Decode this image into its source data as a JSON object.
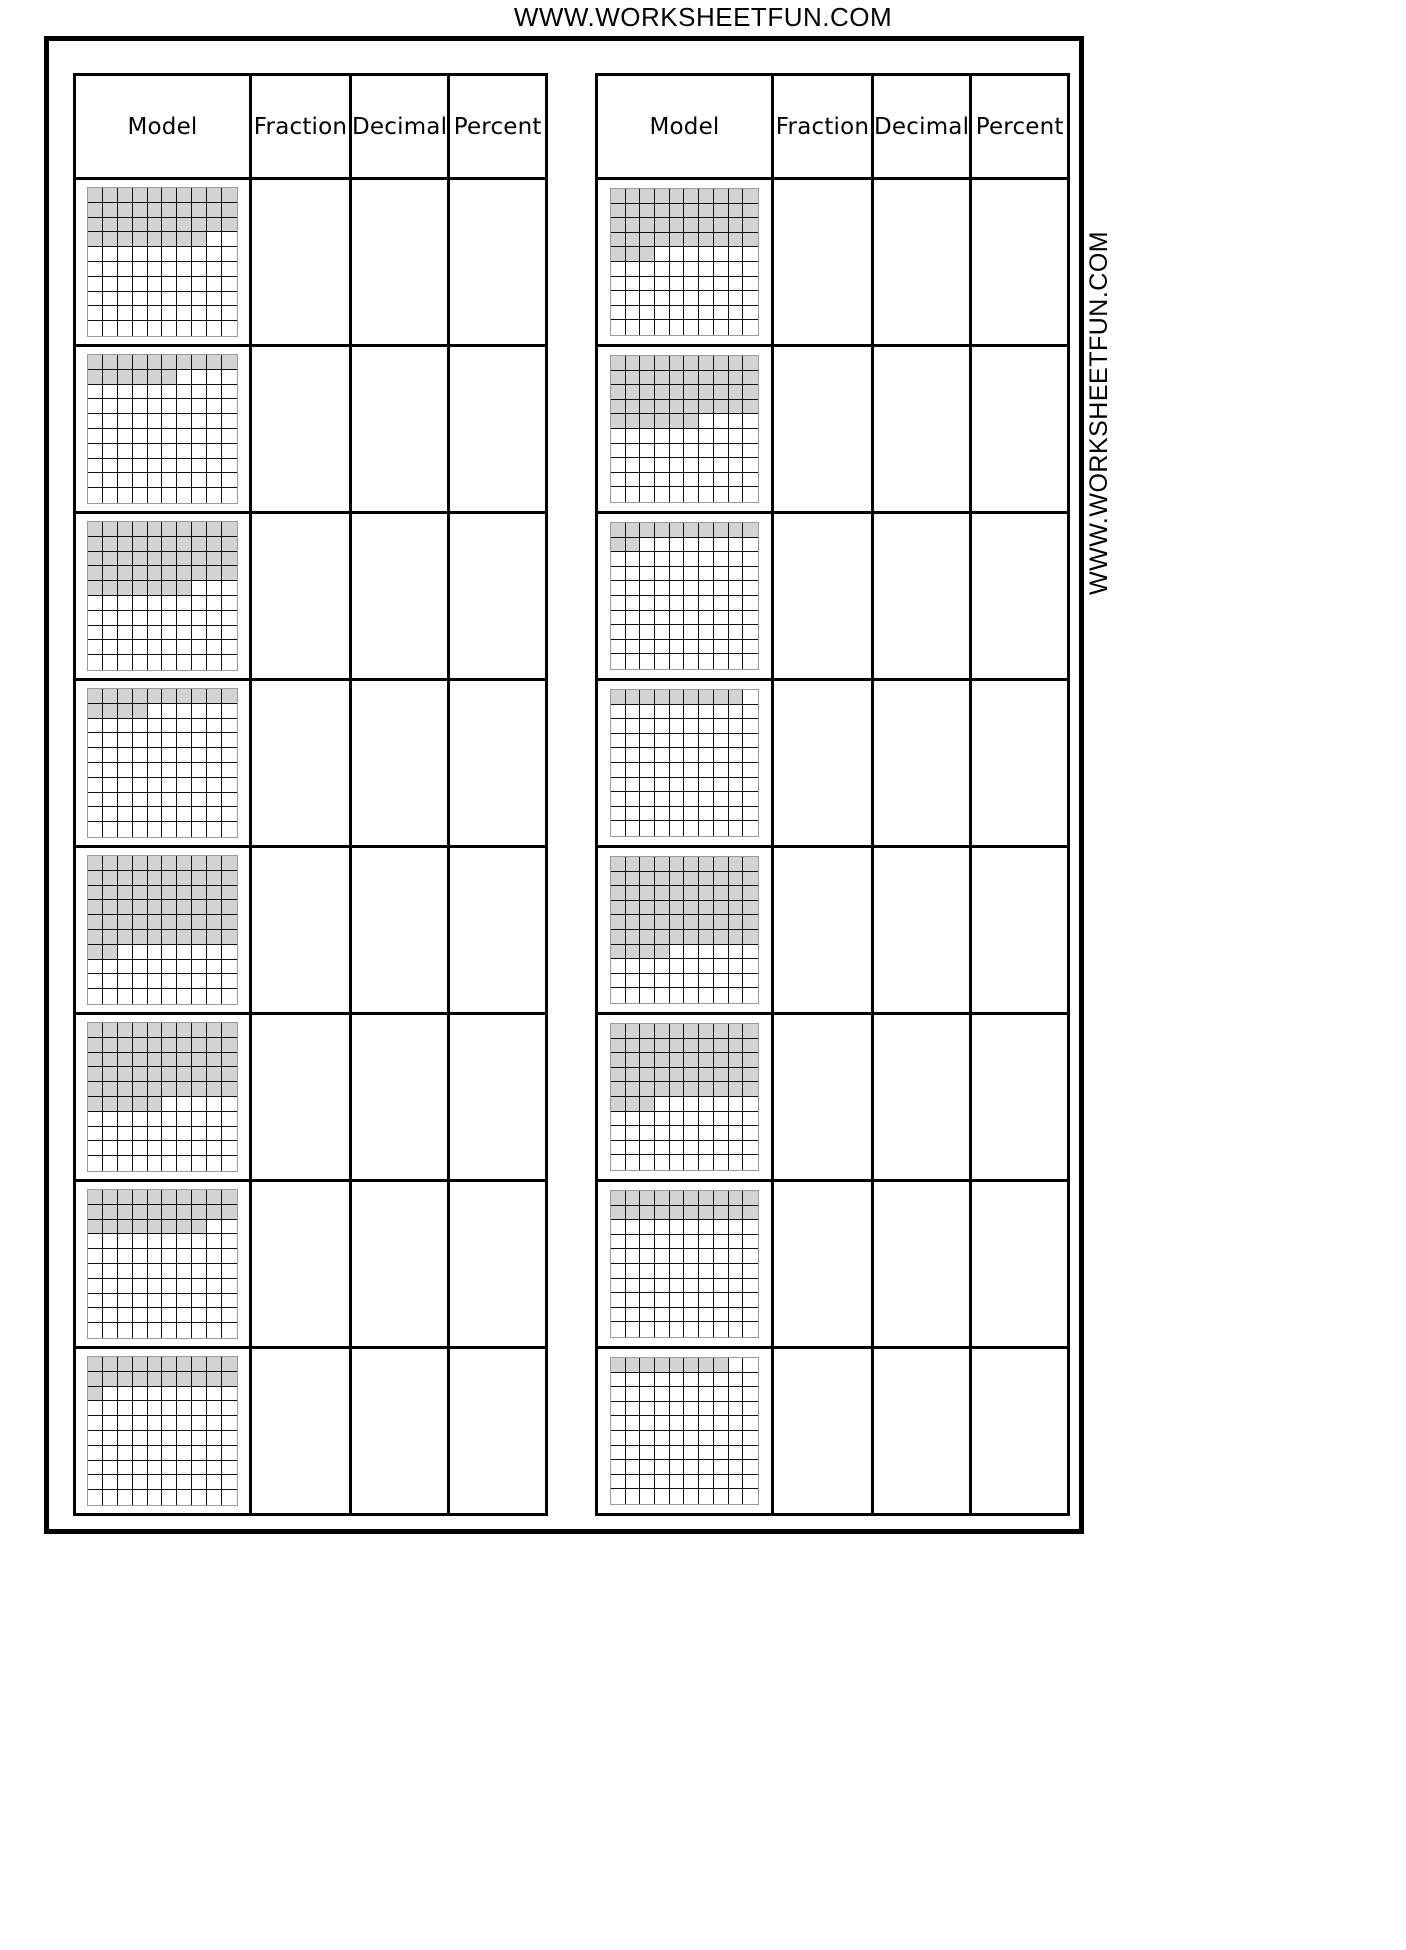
{
  "banners": {
    "top": "WWW.WORKSHEETFUN.COM",
    "side": "WWW.WORKSHEETFUN.COM"
  },
  "table": {
    "headers": {
      "model": "Model",
      "fraction": "Fraction",
      "decimal": "Decimal",
      "percent": "Percent"
    }
  },
  "colors": {
    "shaded_cell": "#d3d3d3",
    "grid_line": "#111111",
    "border": "#000000",
    "background": "#ffffff"
  },
  "chart_data": {
    "type": "table",
    "title": "Model - Fraction - Decimal - Percent",
    "grid_size": 100,
    "grid_rows": 10,
    "grid_cols": 10,
    "columns": [
      "Model",
      "Fraction",
      "Decimal",
      "Percent"
    ],
    "left_table": {
      "rows": [
        {
          "model_shaded": 38,
          "fraction": "",
          "decimal": "",
          "percent": ""
        },
        {
          "model_shaded": 16,
          "fraction": "",
          "decimal": "",
          "percent": ""
        },
        {
          "model_shaded": 47,
          "fraction": "",
          "decimal": "",
          "percent": ""
        },
        {
          "model_shaded": 14,
          "fraction": "",
          "decimal": "",
          "percent": ""
        },
        {
          "model_shaded": 62,
          "fraction": "",
          "decimal": "",
          "percent": ""
        },
        {
          "model_shaded": 55,
          "fraction": "",
          "decimal": "",
          "percent": ""
        },
        {
          "model_shaded": 28,
          "fraction": "",
          "decimal": "",
          "percent": ""
        },
        {
          "model_shaded": 21,
          "fraction": "",
          "decimal": "",
          "percent": ""
        }
      ]
    },
    "right_table": {
      "rows": [
        {
          "model_shaded": 43,
          "fraction": "",
          "decimal": "",
          "percent": ""
        },
        {
          "model_shaded": 46,
          "fraction": "",
          "decimal": "",
          "percent": ""
        },
        {
          "model_shaded": 12,
          "fraction": "",
          "decimal": "",
          "percent": ""
        },
        {
          "model_shaded": 9,
          "fraction": "",
          "decimal": "",
          "percent": ""
        },
        {
          "model_shaded": 64,
          "fraction": "",
          "decimal": "",
          "percent": ""
        },
        {
          "model_shaded": 53,
          "fraction": "",
          "decimal": "",
          "percent": ""
        },
        {
          "model_shaded": 20,
          "fraction": "",
          "decimal": "",
          "percent": ""
        },
        {
          "model_shaded": 8,
          "fraction": "",
          "decimal": "",
          "percent": ""
        }
      ]
    }
  }
}
